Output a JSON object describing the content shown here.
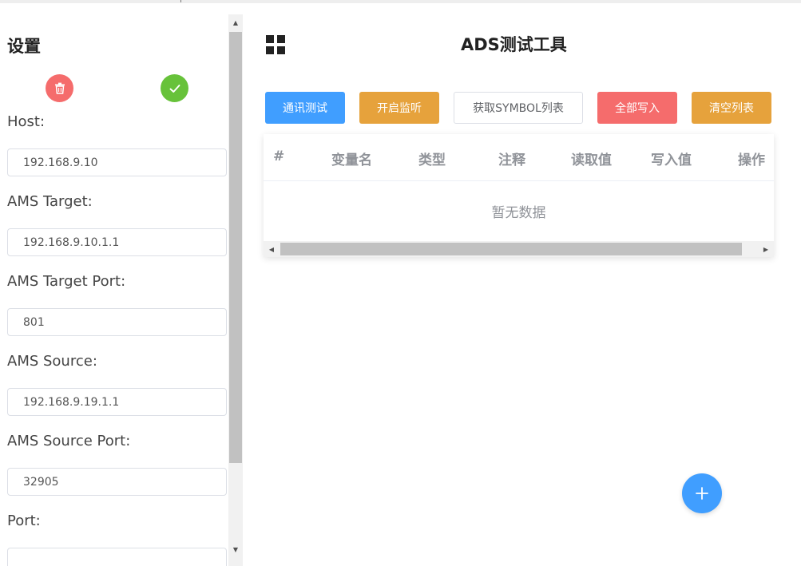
{
  "sidebar": {
    "title": "设置",
    "delete_icon": "trash-icon",
    "confirm_icon": "check-icon",
    "fields": [
      {
        "label": "Host:",
        "value": "192.168.9.10"
      },
      {
        "label": "AMS Target:",
        "value": "192.168.9.10.1.1"
      },
      {
        "label": "AMS Target Port:",
        "value": "801"
      },
      {
        "label": "AMS Source:",
        "value": "192.168.9.19.1.1"
      },
      {
        "label": "AMS Source Port:",
        "value": "32905"
      },
      {
        "label": "Port:",
        "value": ""
      }
    ]
  },
  "header": {
    "title": "ADS测试工具",
    "menu_icon": "grid-icon"
  },
  "toolbar": {
    "comm_test": "通讯测试",
    "start_monitor": "开启监听",
    "get_symbol_list": "获取SYMBOL列表",
    "write_all": "全部写入",
    "clear_list": "清空列表"
  },
  "table": {
    "columns": [
      "#",
      "变量名",
      "类型",
      "注释",
      "读取值",
      "写入值",
      "操作"
    ],
    "rows": [],
    "empty_text": "暂无数据"
  },
  "fab": {
    "icon": "plus-icon"
  },
  "colors": {
    "primary": "#409eff",
    "warning": "#e6a23c",
    "danger": "#f56c6c",
    "success": "#67c23a",
    "header_text": "#909399"
  }
}
